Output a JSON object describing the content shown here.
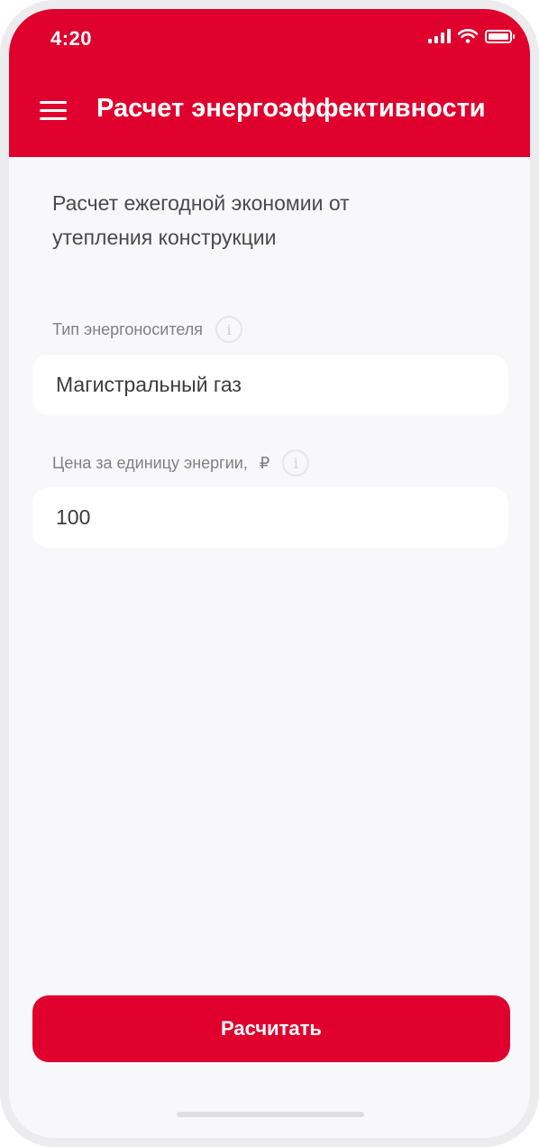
{
  "status_bar": {
    "time": "4:20",
    "icons": [
      "signal-icon",
      "wifi-icon",
      "battery-icon"
    ]
  },
  "header": {
    "title": "Расчет энергоэффективности",
    "menu_icon": "hamburger-menu-icon"
  },
  "intro": {
    "text": "Расчет ежегодной экономии от утепления конструкции"
  },
  "fields": {
    "energy_type": {
      "label": "Тип энергоносителя",
      "value": "Магистральный газ",
      "info_icon": "i"
    },
    "unit_price": {
      "label": "Цена за единицу энергии,",
      "currency": "₽",
      "value": "100",
      "info_icon": "i"
    }
  },
  "actions": {
    "calculate_label": "Расчитать"
  },
  "colors": {
    "brand": "#df002d",
    "background": "#f8f7fa",
    "field_bg": "#ffffff",
    "label": "#808086",
    "text": "#3c3c40"
  }
}
